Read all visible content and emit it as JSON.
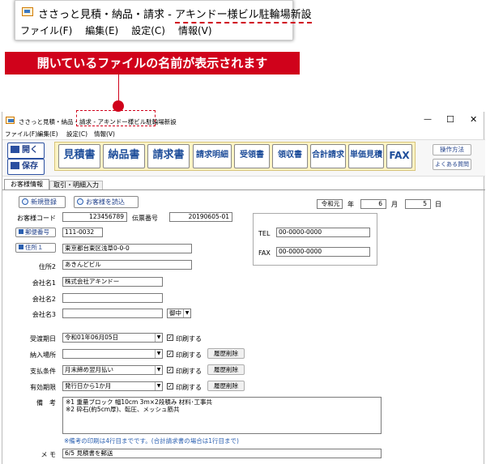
{
  "zoom": {
    "title_prefix": "ささっと見積・納品・請求 - ",
    "title_underlined": "アキンドー様ビル駐輪場新設",
    "menu": [
      "ファイル(F)",
      "編集(E)",
      "設定(C)",
      "情報(V)"
    ]
  },
  "banner": {
    "text": "開いているファイルの名前が表示されます"
  },
  "window": {
    "title": "ささっと見積・納品・請求 - アキンドー様ビル駐輪場新設",
    "controls": {
      "min": "—",
      "max": "☐",
      "close": "✕"
    },
    "menu": [
      "ファイル(F)",
      "編集(E)",
      "設定(C)",
      "情報(V)"
    ]
  },
  "toolbar": {
    "open": "開く",
    "save": "保存",
    "docs": [
      "見積書",
      "納品書",
      "請求書"
    ],
    "docs_small": [
      "請求明細",
      "受領書",
      "領収書",
      "合計請求",
      "単価見積",
      "FAX"
    ],
    "manual": "操作方法",
    "faq": "よくある質問"
  },
  "tabs": [
    "お客様情報",
    "取引・明細入力"
  ],
  "form": {
    "new_register": "新規登録",
    "read_customer": "お客様を読込",
    "era": "令和元",
    "year_unit": "年",
    "month": "6",
    "month_unit": "月",
    "day": "5",
    "day_unit": "日",
    "customer_code_label": "お客様コード",
    "customer_code": "123456789",
    "slip_label": "伝票番号",
    "slip_no": "20190605-01",
    "postal_btn": "郵便番号",
    "postal": "111-0032",
    "address1_btn": "住所１",
    "address1": "東京都台東区浅草0-0-0",
    "address2_label": "住所2",
    "address2": "あきんどビル",
    "company1_label": "会社名1",
    "company1": "株式会社アキンドー",
    "company2_label": "会社名2",
    "company2": "",
    "company3_label": "会社名3",
    "company3": "",
    "honorific": "御中",
    "tel_label": "TEL",
    "tel": "00-0000-0000",
    "fax_label": "FAX",
    "fax": "00-0000-0000",
    "rows": [
      {
        "label": "受渡期日",
        "value": "令和01年06月05日",
        "print": "印刷する",
        "history": ""
      },
      {
        "label": "納入場所",
        "value": "",
        "print": "印刷する",
        "history": "履歴削除"
      },
      {
        "label": "支払条件",
        "value": "月末締め翌月払い",
        "print": "印刷する",
        "history": "履歴削除"
      },
      {
        "label": "有効期限",
        "value": "発行日から1か月",
        "print": "印刷する",
        "history": "履歴削除"
      }
    ],
    "remarks_label": "備　考",
    "remarks_line1": "※1 重量ブロック 幅10cm 3m×2段積み 材料･工事共",
    "remarks_line2": "※2 砕石(約5cm厚)、転圧、メッシュ筋共",
    "remarks_note": "※備考の印刷は4行目までです。(合計請求書の場合は1行目まで)",
    "memo_label": "メ モ",
    "memo": "6/5 見積書を郵送"
  },
  "colors": {
    "accent_red": "#d0021b",
    "button_blue": "#1f4e9a",
    "toolbar_yellow": "#fdf3c4"
  }
}
